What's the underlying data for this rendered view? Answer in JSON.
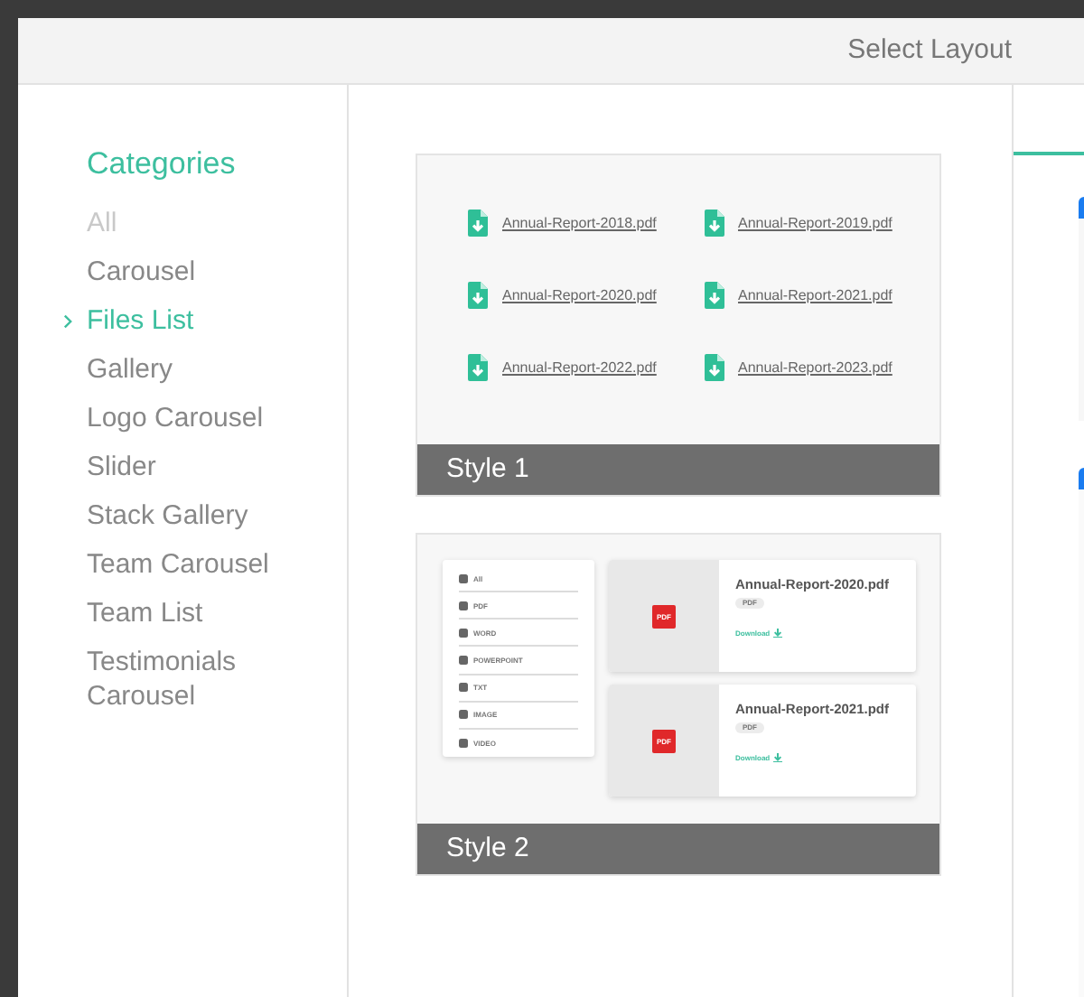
{
  "header": {
    "title": "Select Layout"
  },
  "sidebar": {
    "heading": "Categories",
    "items": [
      {
        "label": "All",
        "selected": false,
        "disabled": true
      },
      {
        "label": "Carousel",
        "selected": false,
        "disabled": false
      },
      {
        "label": "Files List",
        "selected": true,
        "disabled": false
      },
      {
        "label": "Gallery",
        "selected": false,
        "disabled": false
      },
      {
        "label": "Logo Carousel",
        "selected": false,
        "disabled": false
      },
      {
        "label": "Slider",
        "selected": false,
        "disabled": false
      },
      {
        "label": "Stack Gallery",
        "selected": false,
        "disabled": false
      },
      {
        "label": "Team Carousel",
        "selected": false,
        "disabled": false
      },
      {
        "label": "Team List",
        "selected": false,
        "disabled": false
      },
      {
        "label": "Testimonials Carousel",
        "selected": false,
        "disabled": false
      }
    ]
  },
  "layouts": [
    {
      "kind": "links",
      "label": "Style 1",
      "files": [
        "Annual-Report-2018.pdf",
        "Annual-Report-2019.pdf",
        "Annual-Report-2020.pdf",
        "Annual-Report-2021.pdf",
        "Annual-Report-2022.pdf",
        "Annual-Report-2023.pdf"
      ]
    },
    {
      "kind": "cards",
      "label": "Style 2",
      "filters": [
        "All",
        "PDF",
        "WORD",
        "POWERPOINT",
        "TXT",
        "IMAGE",
        "VIDEO"
      ],
      "files": [
        {
          "name": "Annual-Report-2020.pdf",
          "thumb": "PDF",
          "badge": "PDF",
          "action": "Download"
        },
        {
          "name": "Annual-Report-2021.pdf",
          "thumb": "PDF",
          "badge": "PDF",
          "action": "Download"
        }
      ]
    }
  ]
}
